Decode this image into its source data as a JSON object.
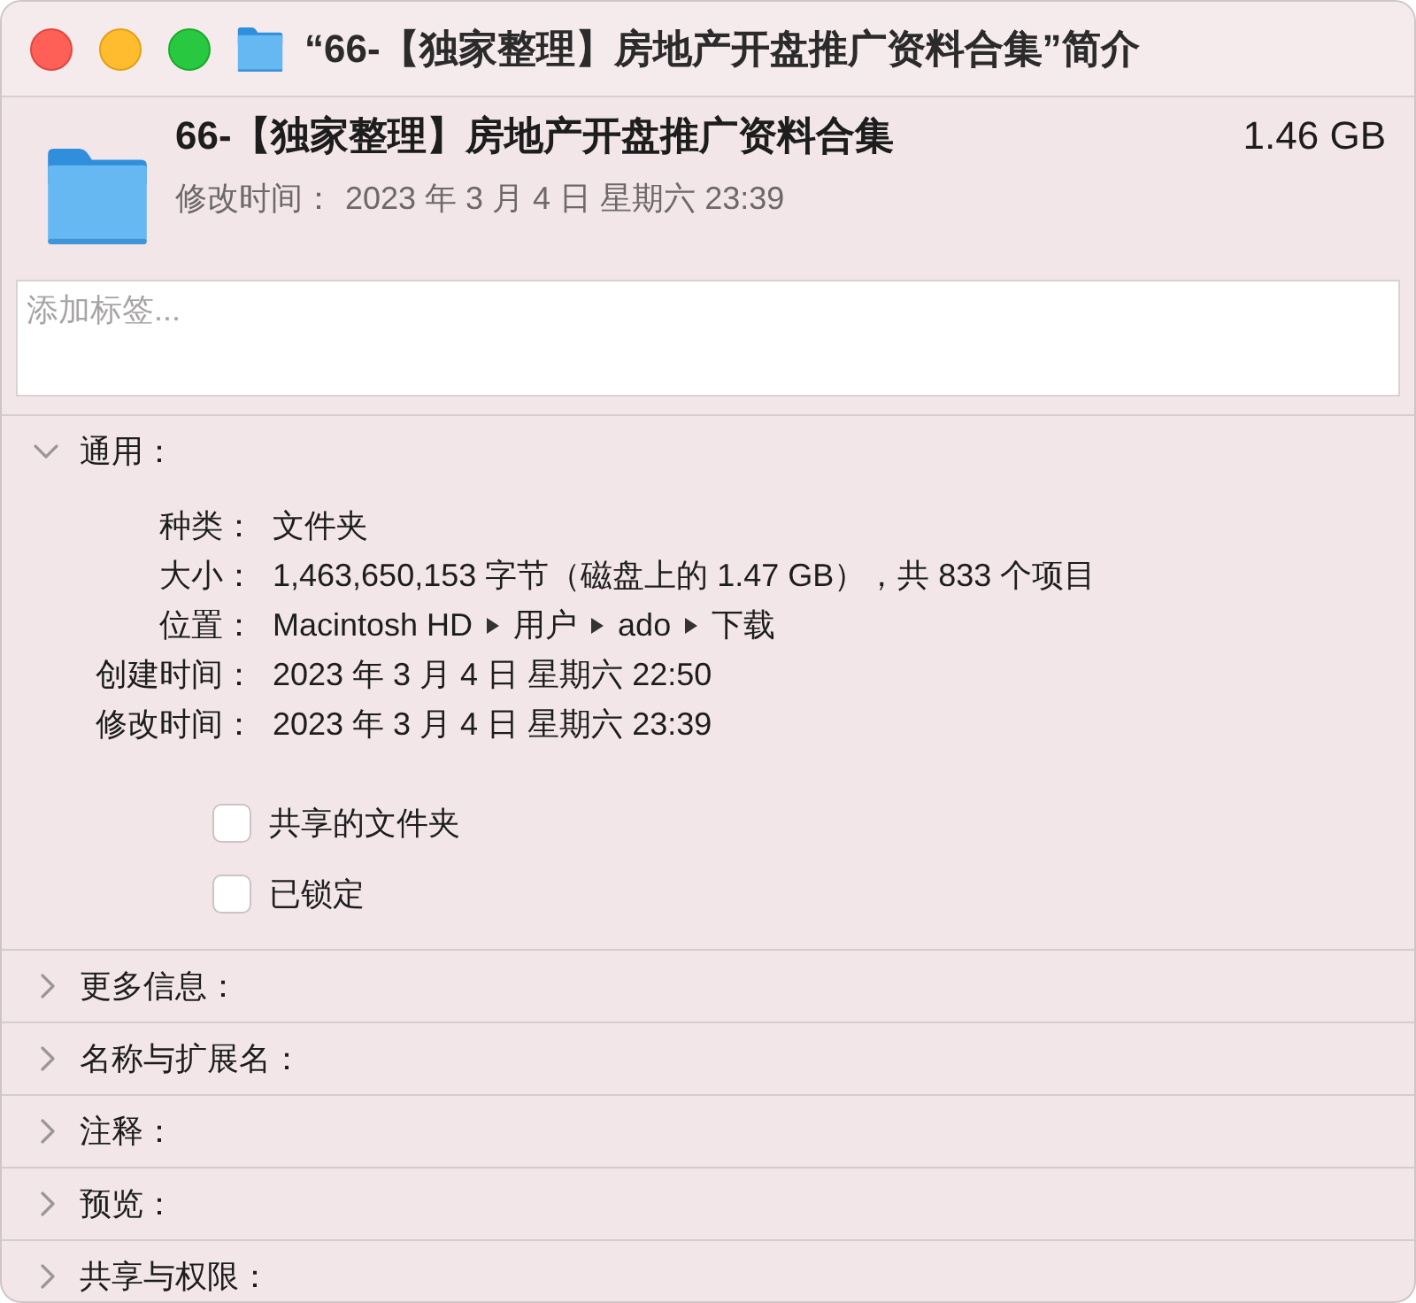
{
  "window": {
    "title": "“66-【独家整理】房地产开盘推广资料合集”简介"
  },
  "header": {
    "name": "66-【独家整理】房地产开盘推广资料合集",
    "size": "1.46 GB",
    "modified_label": "修改时间：",
    "modified_value": "2023 年 3 月 4 日 星期六 23:39"
  },
  "tags": {
    "placeholder": "添加标签..."
  },
  "sections": [
    {
      "label": "通用：",
      "expanded": true,
      "info": [
        {
          "kind": "text",
          "label": "种类：",
          "value": "文件夹"
        },
        {
          "kind": "text",
          "label": "大小：",
          "value": "1,463,650,153 字节（磁盘上的 1.47 GB），共 833 个项目"
        },
        {
          "kind": "path",
          "label": "位置：",
          "path": [
            "Macintosh HD",
            "用户",
            "ado",
            "下载"
          ]
        },
        {
          "kind": "text",
          "label": "创建时间：",
          "value": "2023 年 3 月 4 日 星期六 22:50"
        },
        {
          "kind": "text",
          "label": "修改时间：",
          "value": "2023 年 3 月 4 日 星期六 23:39"
        }
      ],
      "options": [
        {
          "label": "共享的文件夹",
          "checked": false
        },
        {
          "label": "已锁定",
          "checked": false
        }
      ]
    },
    {
      "label": "更多信息：",
      "expanded": false
    },
    {
      "label": "名称与扩展名：",
      "expanded": false
    },
    {
      "label": "注释：",
      "expanded": false
    },
    {
      "label": "预览：",
      "expanded": false
    },
    {
      "label": "共享与权限：",
      "expanded": false
    }
  ]
}
